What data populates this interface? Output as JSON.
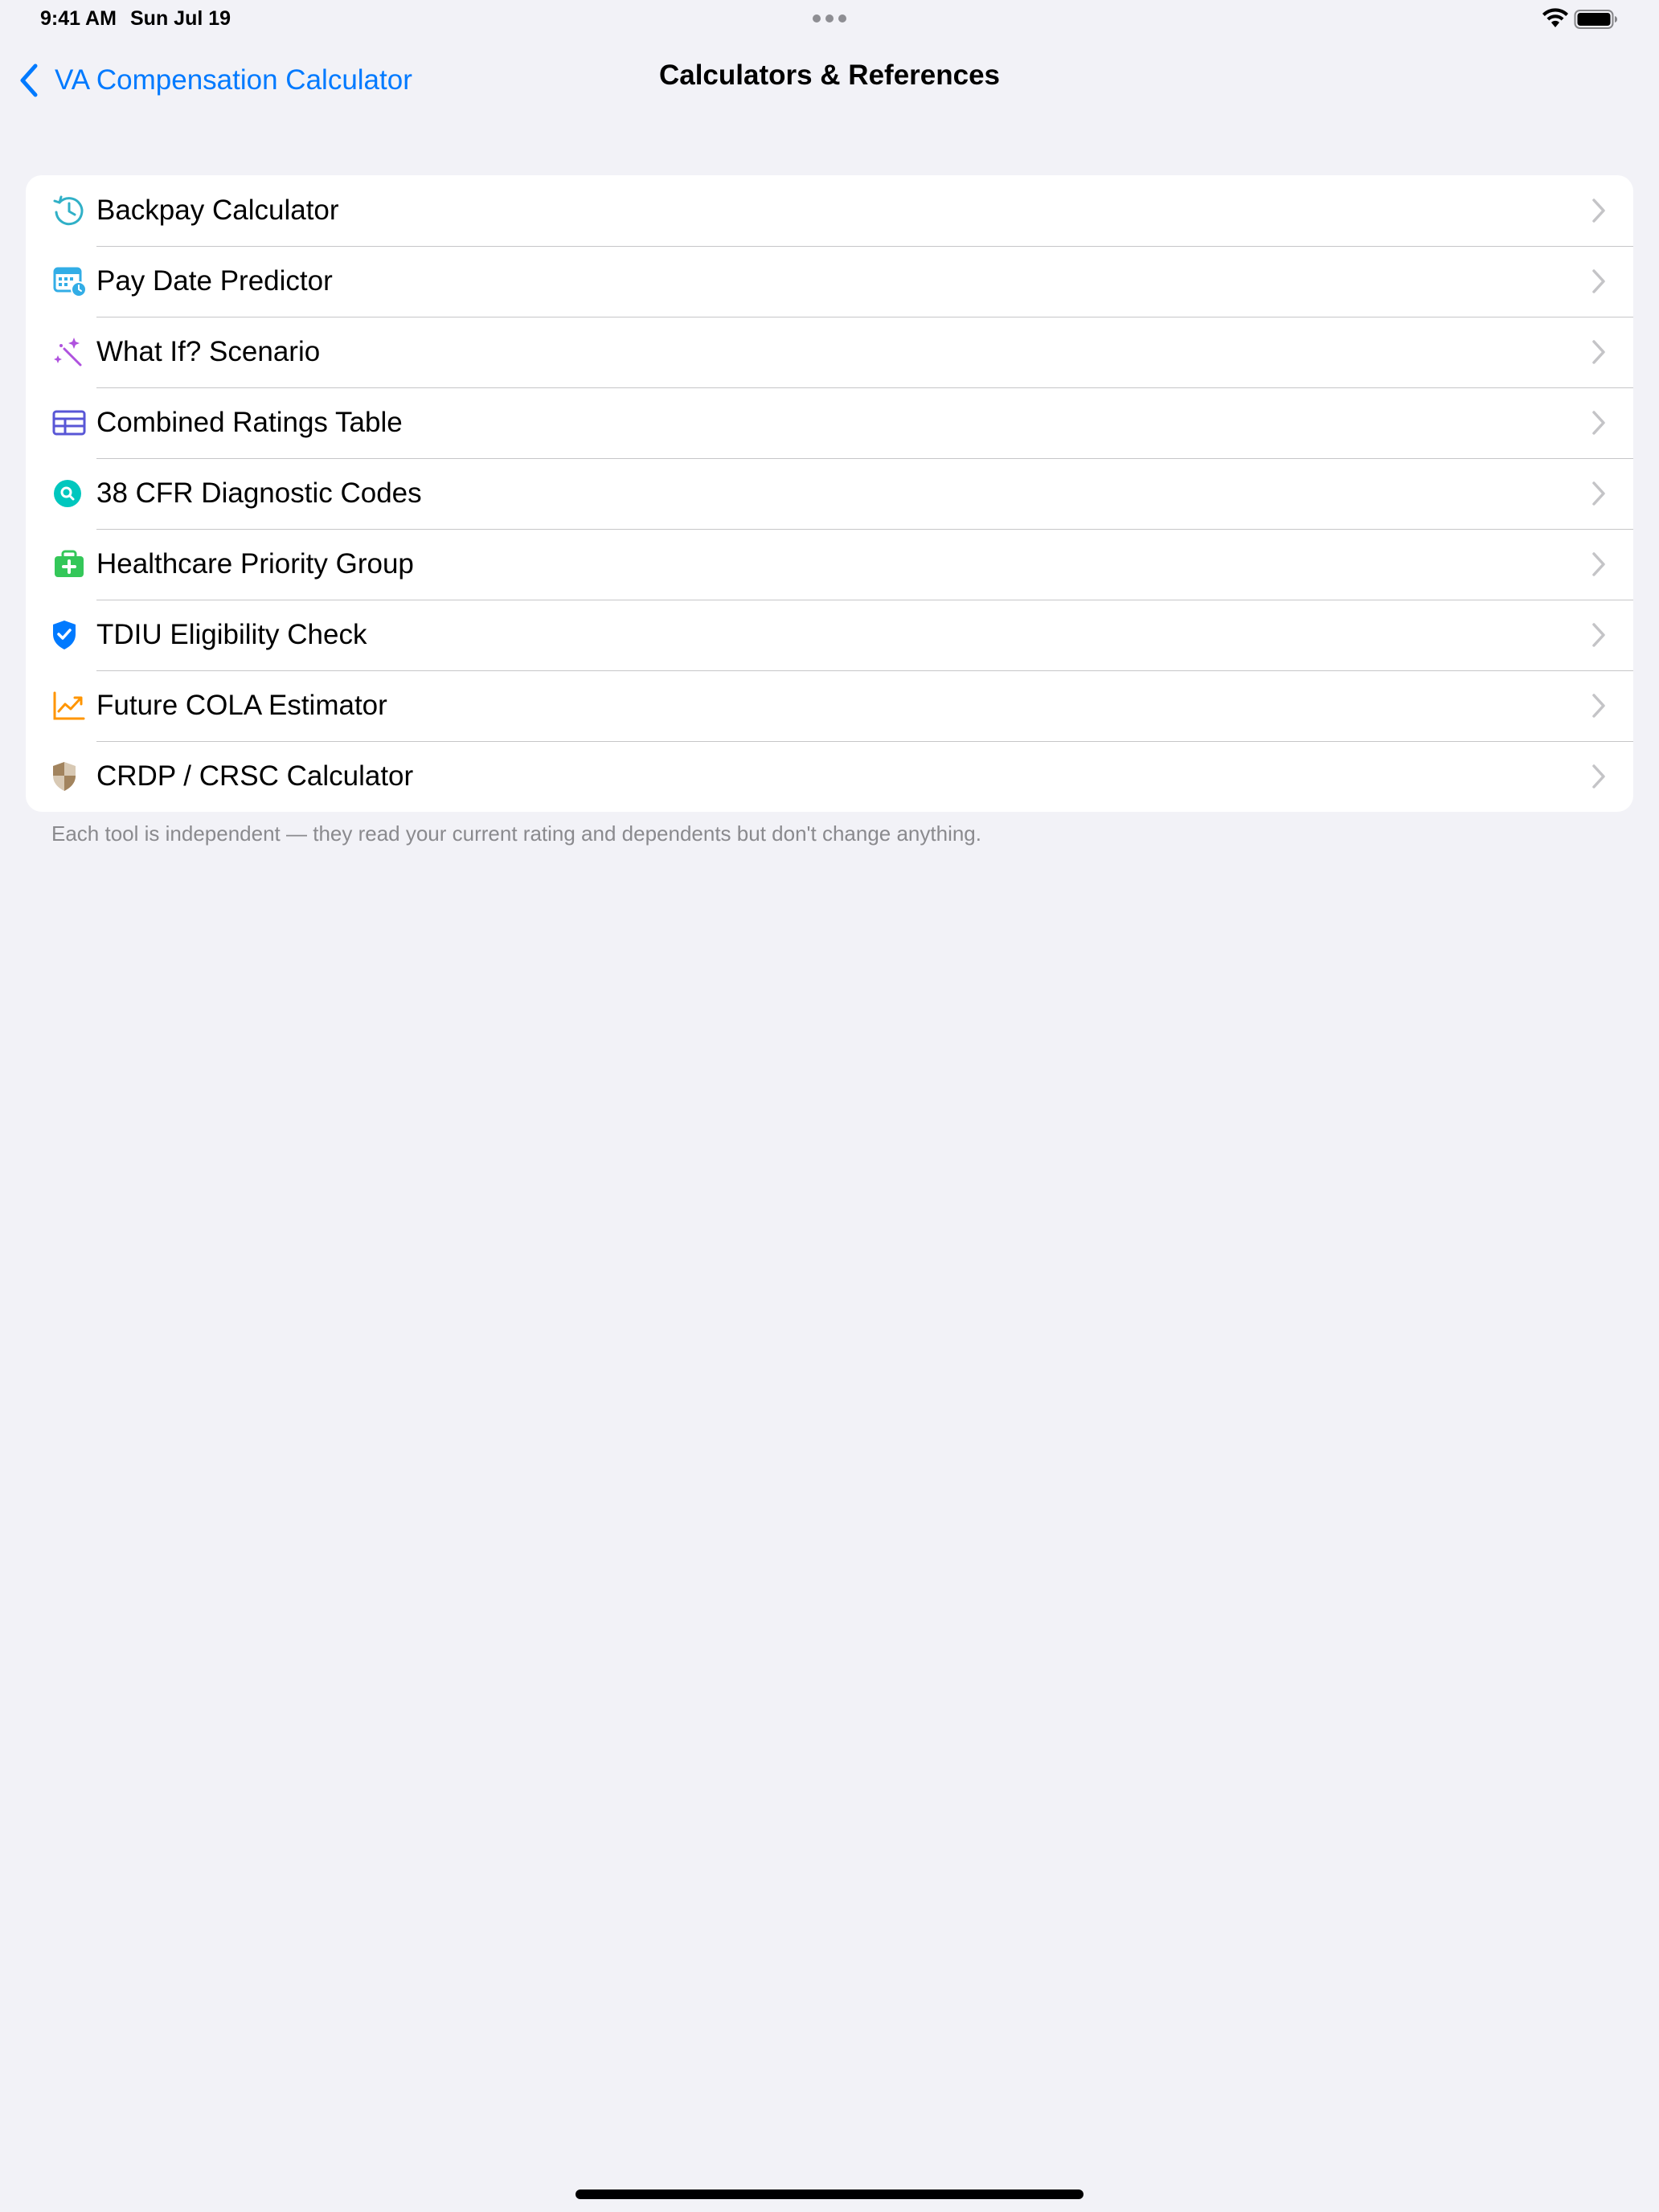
{
  "status_bar": {
    "time": "9:41 AM",
    "date": "Sun Jul 19",
    "icons": [
      "multitask-dots-icon",
      "wifi-icon",
      "battery-icon"
    ]
  },
  "nav": {
    "back_label": "VA Compensation Calculator",
    "title": "Calculators & References"
  },
  "menu": {
    "items": [
      {
        "label": "Backpay Calculator",
        "icon": "clock-history-icon",
        "color": "#30B0C7"
      },
      {
        "label": "Pay Date Predictor",
        "icon": "calendar-clock-icon",
        "color": "#32ADE6"
      },
      {
        "label": "What If? Scenario",
        "icon": "magic-wand-icon",
        "color": "#AF52DE"
      },
      {
        "label": "Combined Ratings Table",
        "icon": "table-icon",
        "color": "#5856D6"
      },
      {
        "label": "38 CFR Diagnostic Codes",
        "icon": "magnifier-circle-icon",
        "color": "#00C7BE"
      },
      {
        "label": "Healthcare Priority Group",
        "icon": "medical-bag-icon",
        "color": "#34C759"
      },
      {
        "label": "TDIU Eligibility Check",
        "icon": "checkmark-shield-icon",
        "color": "#007AFF"
      },
      {
        "label": "Future COLA Estimator",
        "icon": "trend-chart-icon",
        "color": "#FF9500"
      },
      {
        "label": "CRDP / CRSC Calculator",
        "icon": "half-shield-icon",
        "color": "#A2845E"
      }
    ]
  },
  "footer": {
    "note": "Each tool is independent — they read your current rating and dependents but don't change anything."
  },
  "colors": {
    "background": "#F2F2F7",
    "card": "#FFFFFF",
    "accent": "#007AFF",
    "separator": "#C6C6C8",
    "chevron": "#C4C4C7",
    "secondary_text": "#8A8A8E"
  }
}
